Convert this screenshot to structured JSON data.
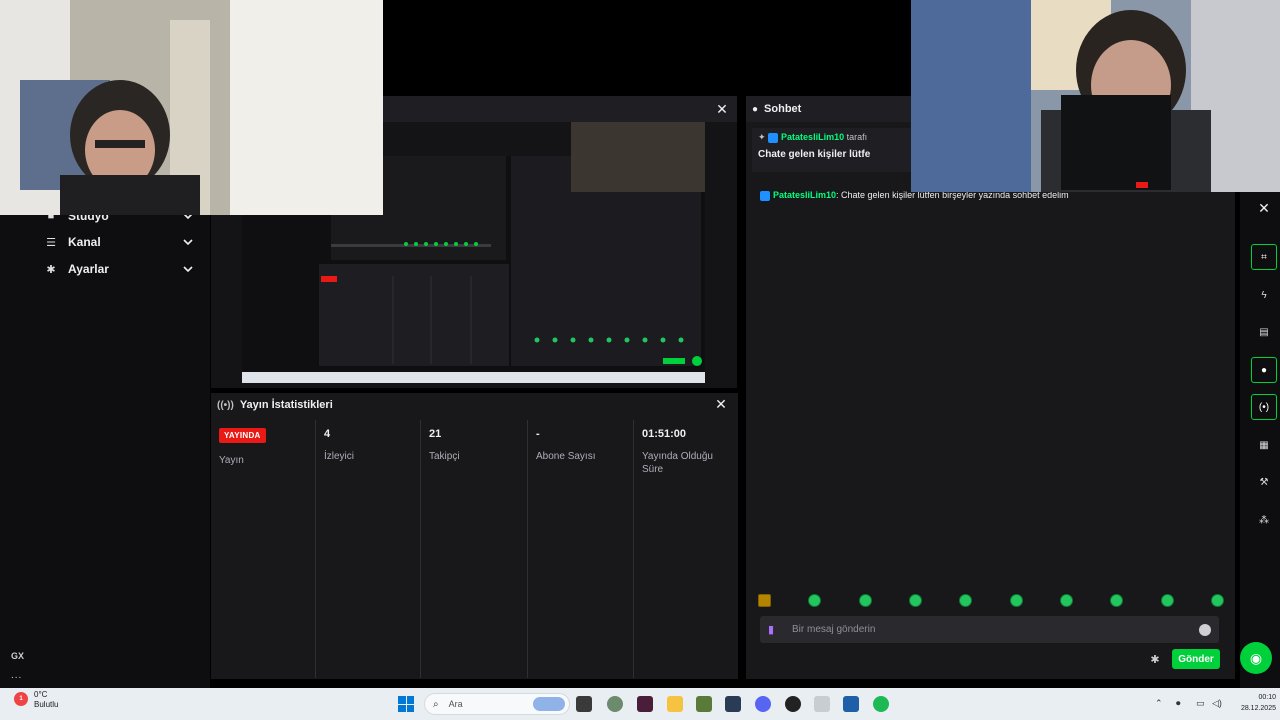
{
  "sidebar": {
    "items": [
      {
        "label": "Stüdyo",
        "icon": "studio-icon"
      },
      {
        "label": "Kanal",
        "icon": "list-icon"
      },
      {
        "label": "Ayarlar",
        "icon": "gear-icon"
      }
    ],
    "footer_gx": "GX",
    "footer_more": "..."
  },
  "preview": {
    "close_icon": "close-icon"
  },
  "stats": {
    "title": "Yayın İstatistikleri",
    "columns": [
      {
        "value": "YAYINDA",
        "label": "Yayın",
        "is_badge": true
      },
      {
        "value": "4",
        "label": "İzleyici"
      },
      {
        "value": "21",
        "label": "Takipçi"
      },
      {
        "value": "-",
        "label": "Abone Sayısı"
      },
      {
        "value": "01:51:00",
        "label": "Yayında Olduğu Süre"
      }
    ]
  },
  "chat": {
    "title": "Sohbet",
    "pinned": {
      "user": "PatatesliLim10",
      "suffix": "tarafı",
      "text": "Chate gelen kişiler lütfe"
    },
    "messages": [
      {
        "user": "PatatesliLim10",
        "text": ": Chate gelen kişiler lütfen birşeyler yazında sohbet edelim"
      }
    ],
    "input_placeholder": "Bir mesaj gönderin",
    "send_label": "Gönder"
  },
  "taskbar": {
    "weather_temp": "0°C",
    "weather_desc": "Bulutlu",
    "weather_badge": "1",
    "search_placeholder": "Ara",
    "time": "00:10",
    "date": "28.12.2025"
  },
  "colors": {
    "accent_green": "#00d13a",
    "live_red": "#e91916",
    "panel_bg": "#18181b",
    "chat_user": "#00ff7f"
  }
}
